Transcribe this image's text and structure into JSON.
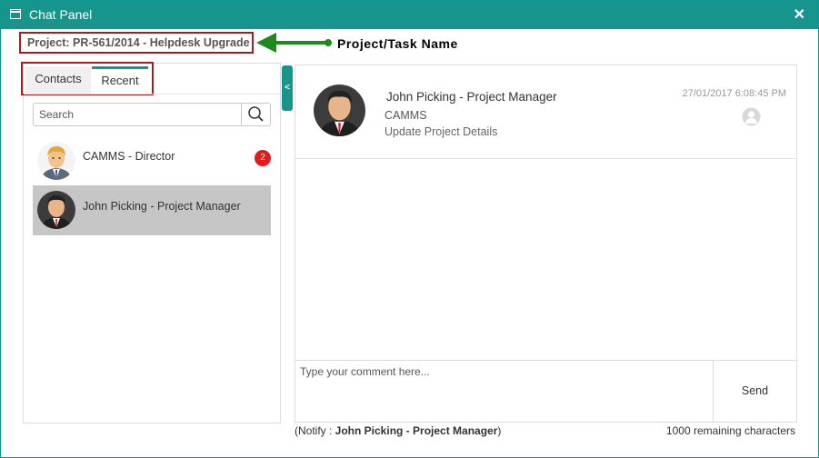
{
  "window": {
    "title": "Chat Panel",
    "close_glyph": "✕"
  },
  "project": {
    "label": "Project: PR-561/2014 - Helpdesk Upgrade"
  },
  "annotation": {
    "text": "Project/Task Name",
    "arrow_color": "#1e8a1e",
    "box_color": "#a71c1f"
  },
  "tabs": [
    {
      "label": "Contacts"
    },
    {
      "label": "Recent"
    }
  ],
  "active_tab": "Recent",
  "search": {
    "placeholder": "Search",
    "icon": "search-icon"
  },
  "contacts": [
    {
      "name": "CAMMS - Director",
      "badge": "2",
      "avatar": "blond-man-avatar",
      "selected": false
    },
    {
      "name": "John Picking - Project Manager",
      "badge": "",
      "avatar": "dark-haired-man-avatar",
      "selected": true
    }
  ],
  "collapse_glyph": "<",
  "message": {
    "sender": "John Picking - Project Manager",
    "org": "CAMMS",
    "body": "Update Project Details",
    "time": "27/01/2017 6:08:45 PM",
    "read_icon": "user-silhouette-icon"
  },
  "composer": {
    "placeholder": "Type your comment here...",
    "send_label": "Send"
  },
  "notify": {
    "prefix": "(Notify : ",
    "name": "John Picking - Project Manager",
    "suffix": ")"
  },
  "remaining": "1000 remaining characters",
  "colors": {
    "accent": "#17958c",
    "badge": "#e01c1c",
    "selected_row": "#c6c6c6"
  }
}
